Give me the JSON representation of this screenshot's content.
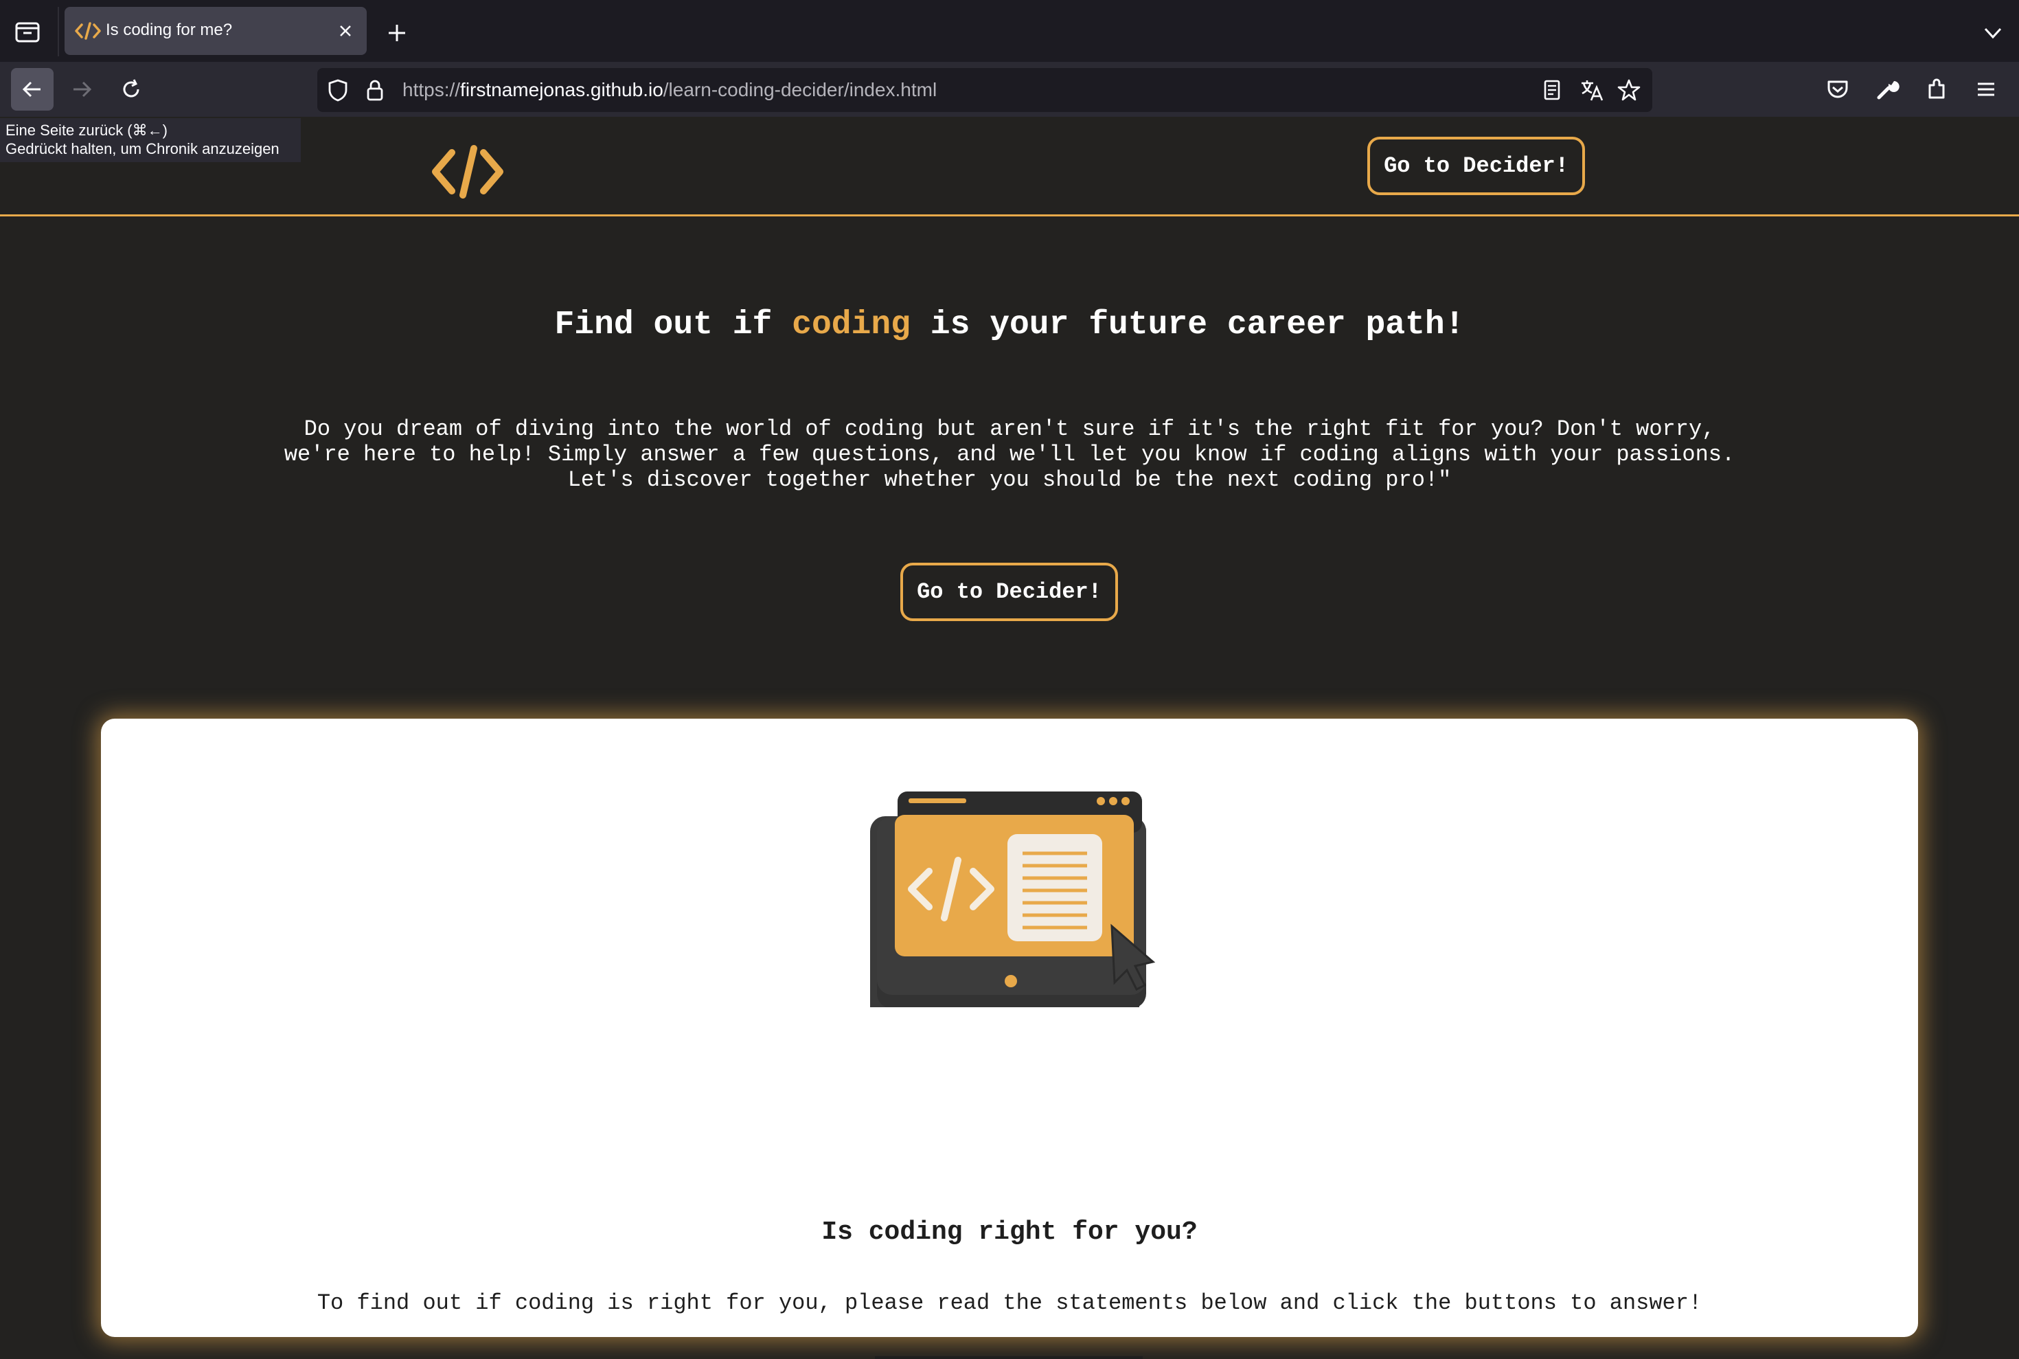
{
  "browser": {
    "tab": {
      "title": "Is coding for me?",
      "favicon": "code-brackets-icon"
    },
    "url": {
      "protocol": "https://",
      "host": "firstnamejonas.github.io",
      "path": "/learn-coding-decider/index.html"
    },
    "tooltip": {
      "line1": "Eine Seite zurück (⌘←)",
      "line2": "Gedrückt halten, um Chronik anzuzeigen"
    },
    "icons": [
      "tab-list-icon",
      "close-icon",
      "plus-icon",
      "chevron-down-icon",
      "back-arrow-icon",
      "forward-arrow-icon",
      "reload-icon",
      "shield-icon",
      "lock-icon",
      "reader-view-icon",
      "translate-icon",
      "star-icon",
      "pocket-icon",
      "wrench-icon",
      "extensions-icon",
      "menu-icon"
    ]
  },
  "header": {
    "logo": "code-brackets-logo",
    "cta_label": "Go to Decider!"
  },
  "hero": {
    "title_before": "Find out if ",
    "title_accent": "coding",
    "title_after": " is your future career path!",
    "line1": "Do you dream of diving into the world of coding but aren't sure if it's the right fit for you? Don't worry,",
    "line2": "we're here to help! Simply answer a few questions, and we'll let you know if coding aligns with your passions.",
    "line3": "Let's discover together whether you should be the next coding pro!\"",
    "cta_label": "Go to Decider!"
  },
  "card": {
    "illustration": "monitor-code-illustration",
    "title": "Is coding right for you?",
    "text": "To find out if coding is right for you, please read the statements below and click the buttons to answer!"
  },
  "colors": {
    "accent": "#e8a94a",
    "page_bg": "#232220",
    "card_bg": "#ffffff"
  }
}
